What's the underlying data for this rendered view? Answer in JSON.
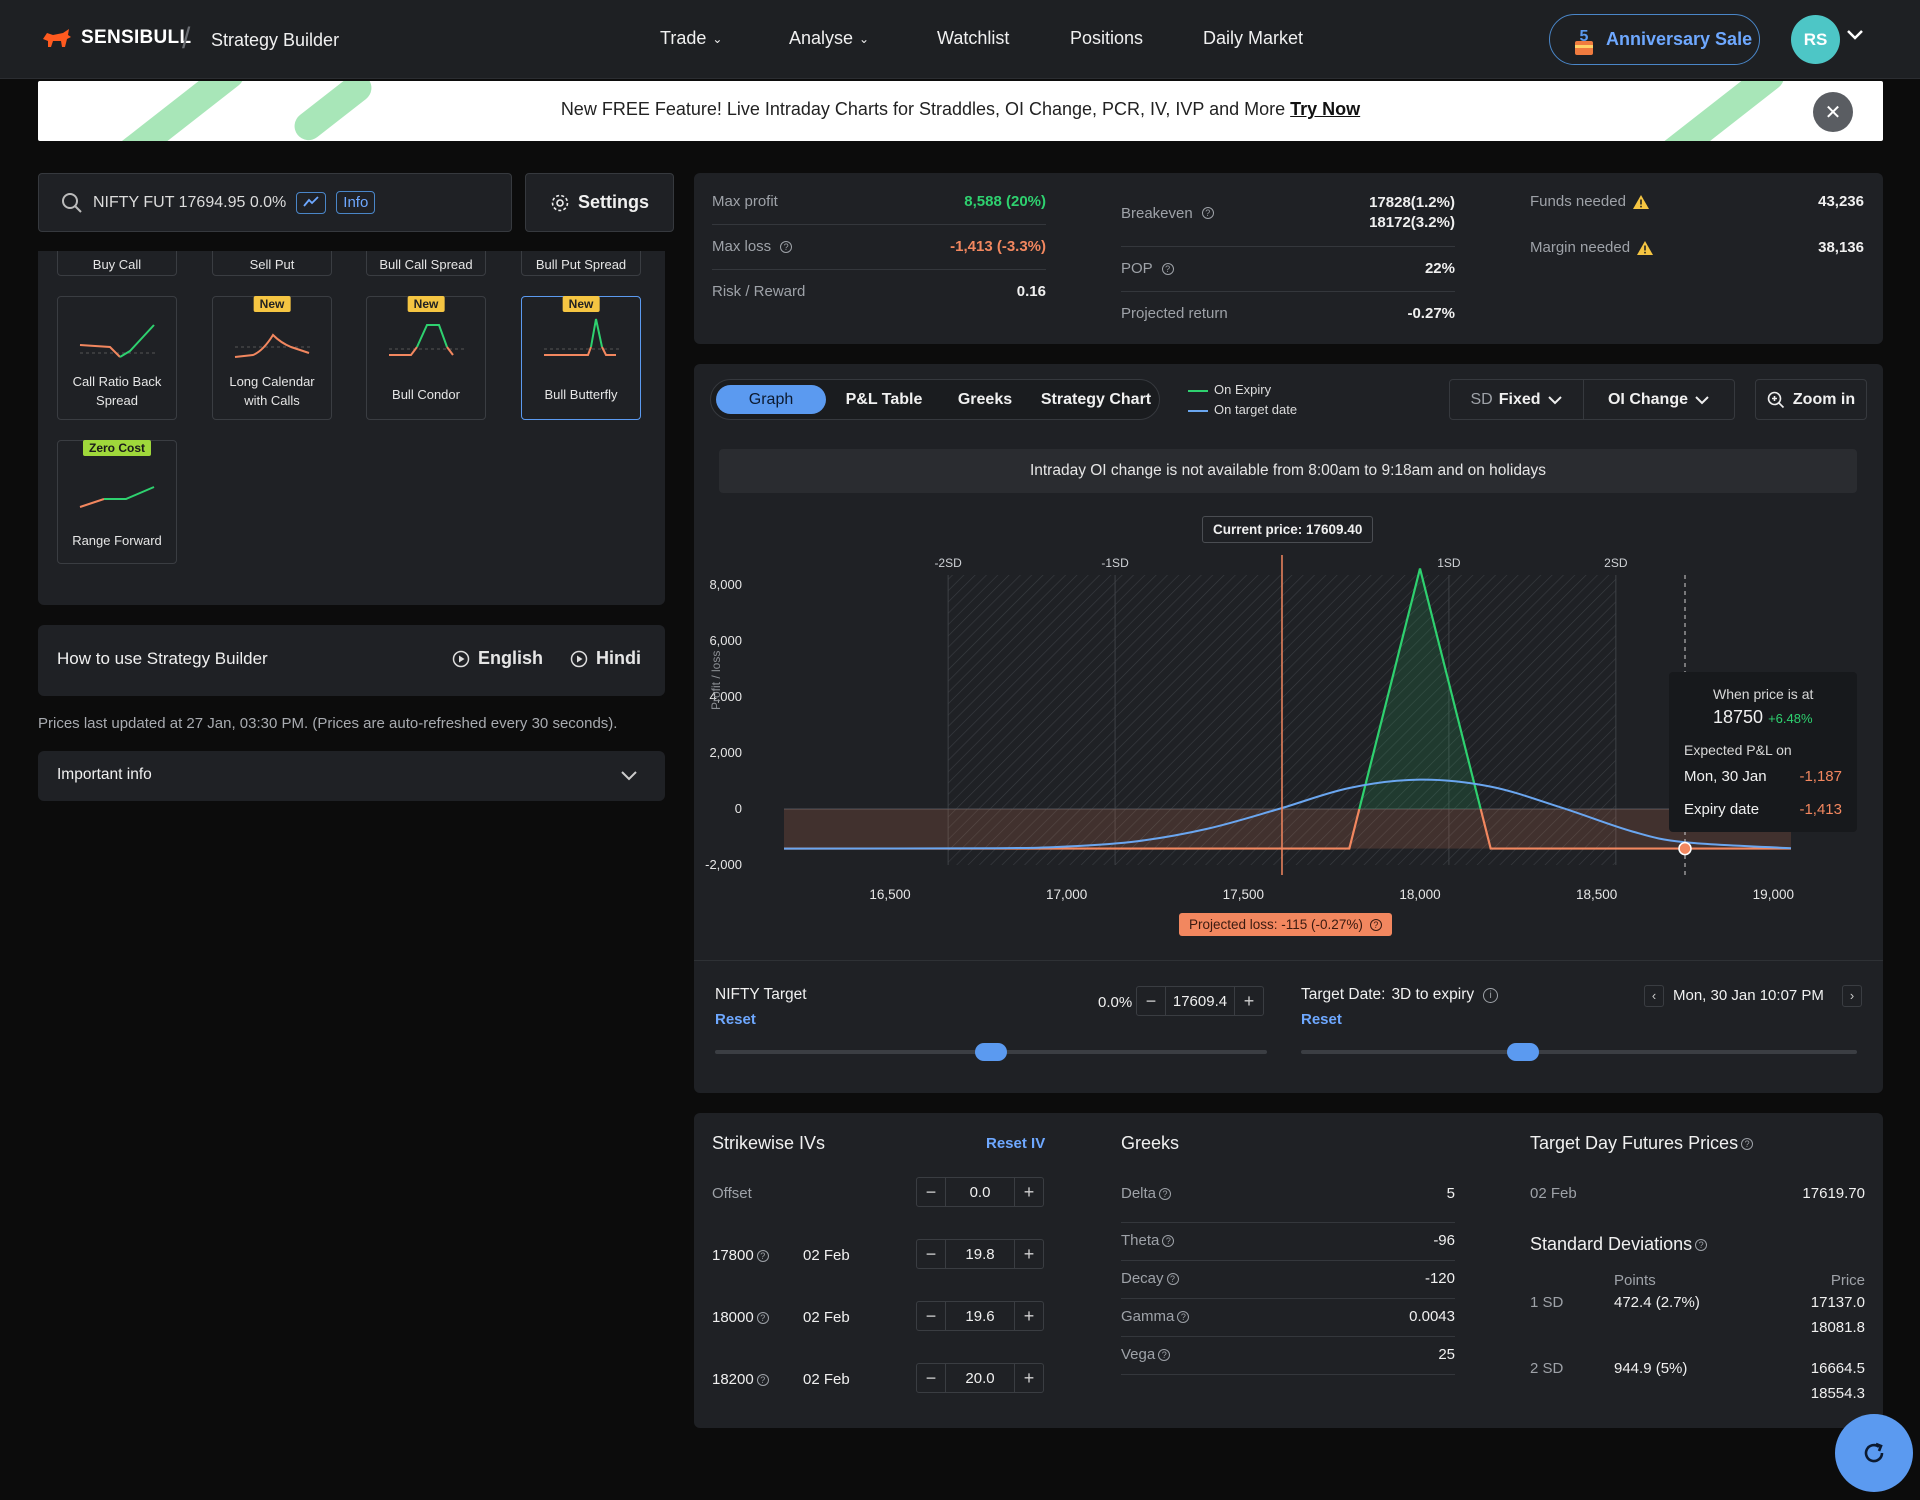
{
  "nav": {
    "brand": "SENSIBULL",
    "crumb": "Strategy Builder",
    "links": [
      "Trade",
      "Analyse",
      "Watchlist",
      "Positions",
      "Daily Market"
    ],
    "anniversary": "Anniversary Sale",
    "avatar": "RS"
  },
  "banner": {
    "text": "New FREE Feature! Live Intraday Charts for Straddles, OI Change, PCR, IV, IVP and More ",
    "cta": "Try Now"
  },
  "search": {
    "text": "NIFTY FUT 17694.95 0.0%",
    "info": "Info",
    "settings": "Settings"
  },
  "strategies": {
    "top_cut": [
      "Buy Call",
      "Sell Put",
      "Bull Call Spread",
      "Bull Put Spread"
    ],
    "cards": [
      {
        "label": "Call Ratio Back Spread",
        "badge": ""
      },
      {
        "label": "Long Calendar with Calls",
        "badge": "New"
      },
      {
        "label": "Bull Condor",
        "badge": "New"
      },
      {
        "label": "Bull Butterfly",
        "badge": "New"
      },
      {
        "label": "Range Forward",
        "badge": "Zero Cost"
      }
    ]
  },
  "howto": {
    "title": "How to use Strategy Builder",
    "english": "English",
    "hindi": "Hindi"
  },
  "prices_note": "Prices last updated at 27 Jan, 03:30 PM. (Prices are auto-refreshed every 30 seconds).",
  "important": "Important info",
  "stats": {
    "max_profit_label": "Max profit",
    "max_profit": "8,588 (20%)",
    "max_loss_label": "Max loss",
    "max_loss": "-1,413 (-3.3%)",
    "rr_label": "Risk / Reward",
    "rr": "0.16",
    "breakeven_label": "Breakeven",
    "breakeven_1": "17828(1.2%)",
    "breakeven_2": "18172(3.2%)",
    "pop_label": "POP",
    "pop": "22%",
    "proj_label": "Projected return",
    "proj": "-0.27%",
    "funds_label": "Funds needed",
    "funds": "43,236",
    "margin_label": "Margin needed",
    "margin": "38,136"
  },
  "graph": {
    "tabs": [
      "Graph",
      "P&L Table",
      "Greeks",
      "Strategy Chart"
    ],
    "legend_expiry": "On Expiry",
    "legend_target": "On target date",
    "sd_label": "SD",
    "sd_value": "Fixed",
    "oi": "OI Change",
    "zoom": "Zoom in",
    "oi_note": "Intraday OI change is not available from 8:00am to 9:18am and on holidays",
    "current_price": "Current price: 17609.40",
    "projected_loss": "Projected loss: -115 (-0.27%)",
    "y_label": "Profit / loss",
    "tooltip": {
      "title": "When price is at",
      "price": "18750",
      "pct": "+6.48%",
      "expected": "Expected P&L on",
      "target_date": "Mon, 30 Jan",
      "target_val": "-1,187",
      "expiry": "Expiry date",
      "expiry_val": "-1,413"
    }
  },
  "chart_data": {
    "type": "line",
    "xlim": [
      16200,
      19050
    ],
    "ylim": [
      -2000,
      8000
    ],
    "x_ticks": [
      "16,500",
      "17,000",
      "17,500",
      "18,000",
      "18,500",
      "19,000"
    ],
    "x_tick_values": [
      16500,
      17000,
      17500,
      18000,
      18500,
      19000
    ],
    "y_ticks": [
      "8,000",
      "6,000",
      "4,000",
      "2,000",
      "0",
      "-2,000"
    ],
    "y_tick_values": [
      8000,
      6000,
      4000,
      2000,
      0,
      -2000
    ],
    "sd_labels": [
      "-2SD",
      "-1SD",
      "1SD",
      "2SD"
    ],
    "sd_values": [
      16664.5,
      17137.0,
      18081.8,
      18554.3
    ],
    "current_price": 17609.4,
    "cursor_price": 18750,
    "series": [
      {
        "name": "On Expiry",
        "color": "#2ed16f",
        "x": [
          16200,
          17800,
          18000,
          18200,
          19050
        ],
        "y": [
          -1413,
          -1413,
          8588,
          -1413,
          -1413
        ]
      },
      {
        "name": "On target date",
        "color": "#6aa6f0",
        "x": [
          16200,
          16800,
          17000,
          17200,
          17400,
          17600,
          17800,
          18000,
          18200,
          18400,
          18600,
          18750,
          19050
        ],
        "y": [
          -1413,
          -1400,
          -1340,
          -1150,
          -700,
          0,
          750,
          1050,
          800,
          50,
          -800,
          -1187,
          -1400
        ]
      }
    ]
  },
  "sliders": {
    "nifty_target": "NIFTY Target",
    "reset": "Reset",
    "pct": "0.0%",
    "price": "17609.4",
    "target_date_label": "Target Date:",
    "target_date_days": "3D to expiry",
    "date_value": "Mon, 30 Jan 10:07 PM",
    "nifty_level": 0.5,
    "date_level": 0.4
  },
  "ivs": {
    "title": "Strikewise IVs",
    "reset": "Reset IV",
    "offset_label": "Offset",
    "offset": "0.0",
    "rows": [
      {
        "strike": "17800",
        "date": "02 Feb",
        "iv": "19.8"
      },
      {
        "strike": "18000",
        "date": "02 Feb",
        "iv": "19.6"
      },
      {
        "strike": "18200",
        "date": "02 Feb",
        "iv": "20.0"
      }
    ]
  },
  "greeks": {
    "title": "Greeks",
    "rows": [
      {
        "k": "Delta",
        "v": "5"
      },
      {
        "k": "Theta",
        "v": "-96"
      },
      {
        "k": "Decay",
        "v": "-120"
      },
      {
        "k": "Gamma",
        "v": "0.0043"
      },
      {
        "k": "Vega",
        "v": "25"
      }
    ]
  },
  "futures": {
    "title": "Target Day Futures Prices",
    "date": "02 Feb",
    "price": "17619.70",
    "sd_title": "Standard Deviations",
    "points_hdr": "Points",
    "price_hdr": "Price",
    "sd1": "1 SD",
    "sd1_points": "472.4 (2.7%)",
    "sd1_lo": "17137.0",
    "sd1_hi": "18081.8",
    "sd2": "2 SD",
    "sd2_points": "944.9 (5%)",
    "sd2_lo": "16664.5",
    "sd2_hi": "18554.3"
  },
  "colors": {
    "accent": "#5b9af0",
    "profit": "#2ed16f",
    "loss": "#f2875f",
    "bg": "#0c0c0c",
    "panel": "#1f2125"
  }
}
